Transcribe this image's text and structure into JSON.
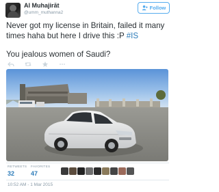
{
  "tweet": {
    "display_name": "Al Muhajirāt",
    "username": "@umm_muthanna2",
    "follow_label": "Follow",
    "text_line1": "Never got my license in Britain, failed it many",
    "text_line2_pre": "times haha but here I drive this :P ",
    "hashtag": "#IS",
    "text_line3": "You jealous women of Saudi?",
    "retweets_label": "RETWEETS",
    "retweets_count": "32",
    "favorites_label": "FAVORITES",
    "favorites_count": "47",
    "timestamp": "10:52 AM - 1 Mar 2015"
  },
  "icons": [
    "avatar",
    "follow-user-icon",
    "reply-icon",
    "retweet-icon",
    "favorite-icon",
    "more-icon"
  ],
  "colors": {
    "link": "#2b7bb9",
    "follow": "#55acee",
    "meta": "#8899a6",
    "text": "#292f33"
  }
}
